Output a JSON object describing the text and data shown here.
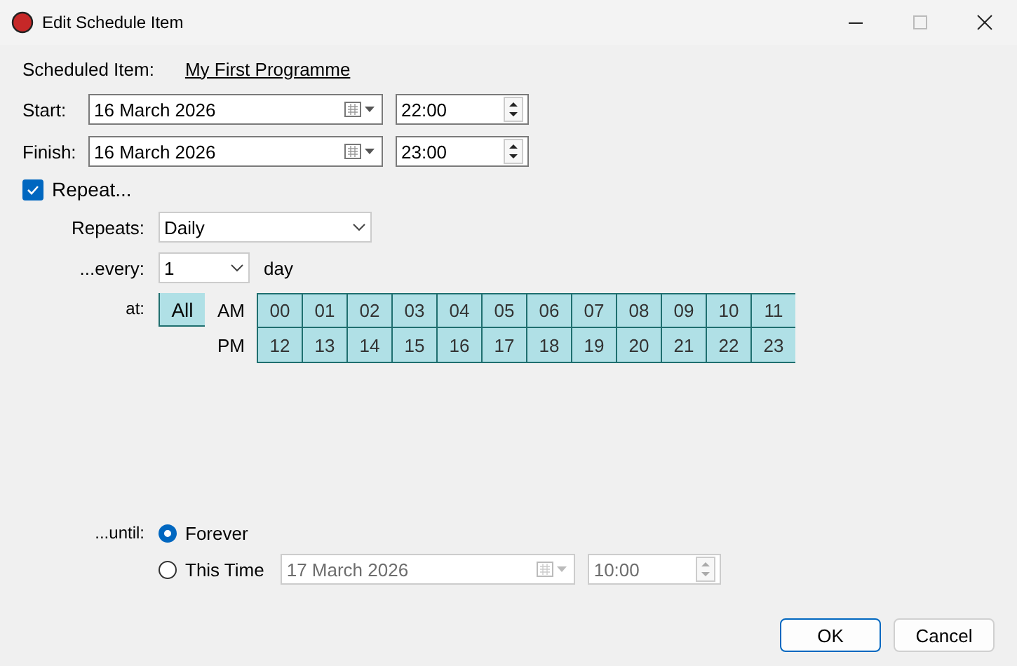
{
  "window": {
    "title": "Edit Schedule Item",
    "maximize_disabled": true
  },
  "scheduled_item": {
    "label": "Scheduled Item:",
    "value": "My First Programme"
  },
  "start": {
    "label": "Start:",
    "date": "16 March 2026",
    "time": "22:00"
  },
  "finish": {
    "label": "Finish:",
    "date": "16 March 2026",
    "time": "23:00"
  },
  "repeat": {
    "label": "Repeat...",
    "checked": true
  },
  "repeats": {
    "label": "Repeats:",
    "value": "Daily"
  },
  "every": {
    "label": "...every:",
    "value": "1",
    "unit": "day"
  },
  "at": {
    "label": "at:",
    "all": {
      "label": "All",
      "selected": true
    },
    "rows": [
      {
        "label": "AM",
        "hours": [
          {
            "label": "00",
            "selected": true
          },
          {
            "label": "01",
            "selected": true
          },
          {
            "label": "02",
            "selected": true
          },
          {
            "label": "03",
            "selected": true
          },
          {
            "label": "04",
            "selected": true
          },
          {
            "label": "05",
            "selected": true
          },
          {
            "label": "06",
            "selected": true
          },
          {
            "label": "07",
            "selected": true
          },
          {
            "label": "08",
            "selected": true
          },
          {
            "label": "09",
            "selected": true
          },
          {
            "label": "10",
            "selected": true
          },
          {
            "label": "11",
            "selected": true
          }
        ]
      },
      {
        "label": "PM",
        "hours": [
          {
            "label": "12",
            "selected": true
          },
          {
            "label": "13",
            "selected": true
          },
          {
            "label": "14",
            "selected": true
          },
          {
            "label": "15",
            "selected": true
          },
          {
            "label": "16",
            "selected": true
          },
          {
            "label": "17",
            "selected": true
          },
          {
            "label": "18",
            "selected": true
          },
          {
            "label": "19",
            "selected": true
          },
          {
            "label": "20",
            "selected": true
          },
          {
            "label": "21",
            "selected": true
          },
          {
            "label": "22",
            "selected": true
          },
          {
            "label": "23",
            "selected": true
          }
        ]
      }
    ]
  },
  "until": {
    "label": "...until:",
    "options": [
      {
        "label": "Forever",
        "selected": true
      },
      {
        "label": "This Time",
        "selected": false
      }
    ],
    "date": "17 March 2026",
    "time": "10:00",
    "disabled": true
  },
  "buttons": [
    {
      "label": "OK",
      "default": true
    },
    {
      "label": "Cancel",
      "default": false
    }
  ]
}
